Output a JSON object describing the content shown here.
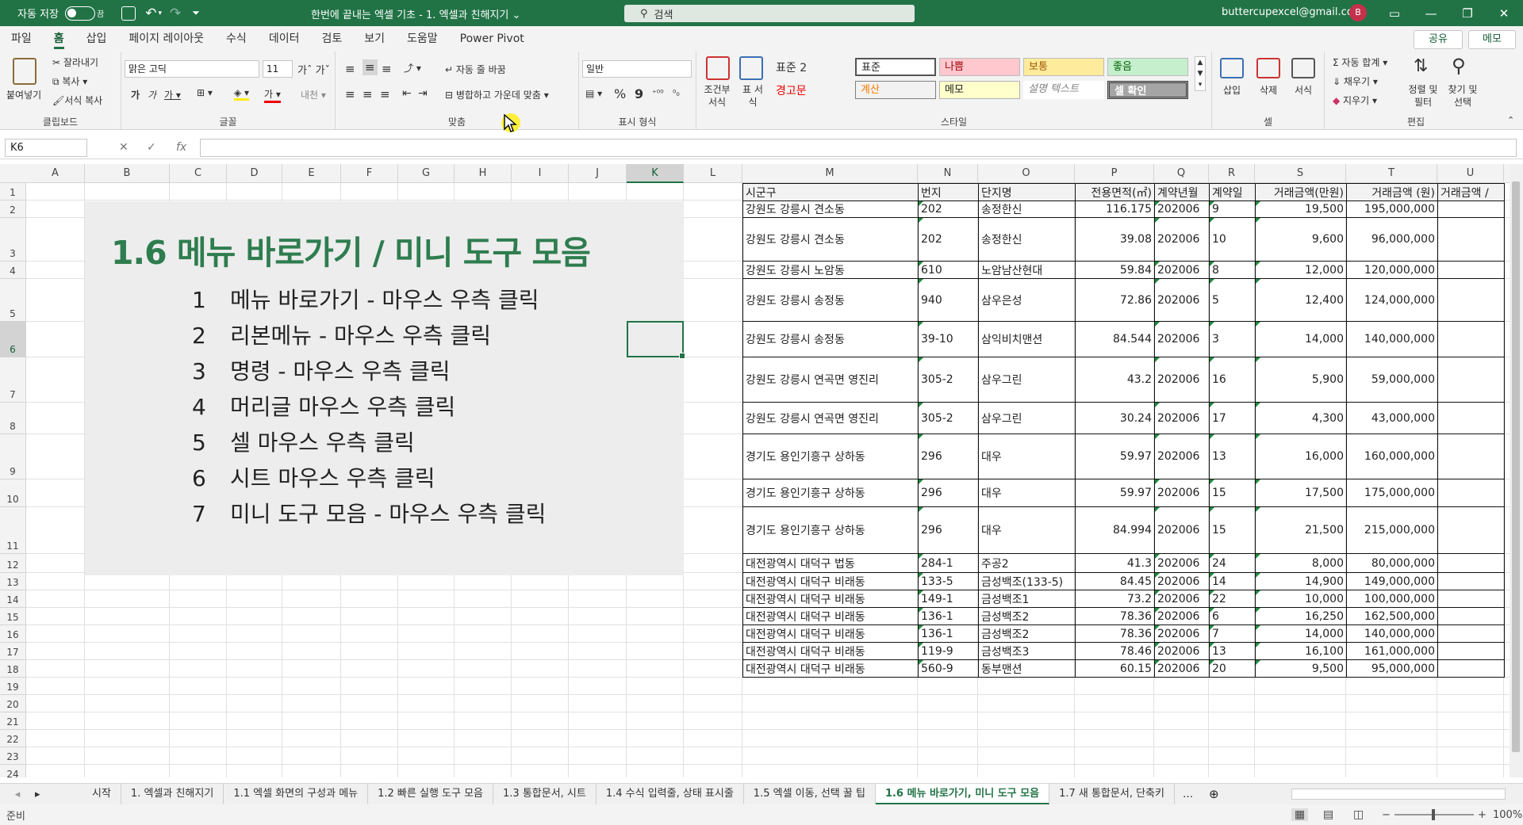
{
  "titlebar": {
    "autosave": "자동 저장",
    "autosave_state": "끔",
    "title": "한번에 끝내는 엑셀 기초 - 1. 엑셀과 친해지기 ⌄",
    "search": "검색",
    "account": "buttercupexcel@gmail.com",
    "avatar": "B"
  },
  "menu": [
    "파일",
    "홈",
    "삽입",
    "페이지 레이아웃",
    "수식",
    "데이터",
    "검토",
    "보기",
    "도움말",
    "Power Pivot"
  ],
  "share": "공유",
  "memo": "메모",
  "ribbon": {
    "clipboard": {
      "label": "클립보드",
      "paste": "붙여넣기",
      "cut": "잘라내기",
      "copy": "복사",
      "format_painter": "서식 복사"
    },
    "font": {
      "label": "글꼴",
      "name": "맑은 고딕",
      "size": "11"
    },
    "align": {
      "label": "맞춤",
      "wrap": "자동 줄 바꿈",
      "merge": "병합하고 가운데 맞춤"
    },
    "number": {
      "label": "표시 형식",
      "format": "일반"
    },
    "styles": {
      "label": "스타일",
      "cond": "조건부 서식",
      "table": "표 서식",
      "style_name": "표준 2",
      "warn": "경고문",
      "cells": [
        "표준",
        "나쁨",
        "보통",
        "좋음",
        "계산",
        "메모",
        "설명 텍스트",
        "셀 확인"
      ]
    },
    "cells": {
      "label": "셀",
      "insert": "삽입",
      "delete": "삭제",
      "format": "서식"
    },
    "edit": {
      "label": "편집",
      "autosum": "자동 합계",
      "fill": "채우기",
      "clear": "지우기",
      "sort": "정렬 및 필터",
      "find": "찾기 및 선택"
    }
  },
  "namebox": "K6",
  "columns": [
    "A",
    "B",
    "C",
    "D",
    "E",
    "F",
    "G",
    "H",
    "I",
    "J",
    "K",
    "L",
    "M",
    "N",
    "O",
    "P",
    "Q",
    "R",
    "S",
    "T",
    "U"
  ],
  "rows": [
    "1",
    "2",
    "3",
    "4",
    "5",
    "6",
    "7",
    "8",
    "9",
    "10",
    "11",
    "12",
    "13",
    "14",
    "15",
    "16",
    "17",
    "18",
    "19",
    "20",
    "21",
    "22",
    "23",
    "24"
  ],
  "slide": {
    "title": "1.6 메뉴 바로가기 / 미니 도구 모음",
    "items": [
      {
        "n": "1",
        "text": "메뉴 바로가기  - 마우스 우측 클릭"
      },
      {
        "n": "2",
        "text": "리본메뉴 - 마우스 우측 클릭"
      },
      {
        "n": "3",
        "text": "명령 - 마우스 우측 클릭"
      },
      {
        "n": "4",
        "text": "머리글 마우스 우측 클릭"
      },
      {
        "n": "5",
        "text": "셀 마우스 우측 클릭"
      },
      {
        "n": "6",
        "text": "시트 마우스 우측 클릭"
      },
      {
        "n": "7",
        "text": "미니 도구 모음 - 마우스 우측 클릭"
      }
    ]
  },
  "table": {
    "headers": [
      "시군구",
      "번지",
      "단지명",
      "전용면적(㎡)",
      "계약년월",
      "계약일",
      "거래금액(만원)",
      "거래금액 (원)",
      "거래금액 / "
    ],
    "rows": [
      [
        "강원도 강릉시 견소동",
        "202",
        "송정한신",
        "116.175",
        "202006",
        "9",
        "19,500",
        "195,000,000"
      ],
      [
        "강원도 강릉시 견소동",
        "202",
        "송정한신",
        "39.08",
        "202006",
        "10",
        "9,600",
        "96,000,000"
      ],
      [
        "강원도 강릉시 노암동",
        "610",
        "노암남산현대",
        "59.84",
        "202006",
        "8",
        "12,000",
        "120,000,000"
      ],
      [
        "강원도 강릉시 송정동",
        "940",
        "삼우은성",
        "72.86",
        "202006",
        "5",
        "12,400",
        "124,000,000"
      ],
      [
        "강원도 강릉시 송정동",
        "39-10",
        "삼익비치맨션",
        "84.544",
        "202006",
        "3",
        "14,000",
        "140,000,000"
      ],
      [
        "강원도 강릉시 연곡면 영진리",
        "305-2",
        "삼우그린",
        "43.2",
        "202006",
        "16",
        "5,900",
        "59,000,000"
      ],
      [
        "강원도 강릉시 연곡면 영진리",
        "305-2",
        "삼우그린",
        "30.24",
        "202006",
        "17",
        "4,300",
        "43,000,000"
      ],
      [
        "경기도 용인기흥구 상하동",
        "296",
        "대우",
        "59.97",
        "202006",
        "13",
        "16,000",
        "160,000,000"
      ],
      [
        "경기도 용인기흥구 상하동",
        "296",
        "대우",
        "59.97",
        "202006",
        "15",
        "17,500",
        "175,000,000"
      ],
      [
        "경기도 용인기흥구 상하동",
        "296",
        "대우",
        "84.994",
        "202006",
        "15",
        "21,500",
        "215,000,000"
      ],
      [
        "대전광역시 대덕구 법동",
        "284-1",
        "주공2",
        "41.3",
        "202006",
        "24",
        "8,000",
        "80,000,000"
      ],
      [
        "대전광역시 대덕구 비래동",
        "133-5",
        "금성백조(133-5)",
        "84.45",
        "202006",
        "14",
        "14,900",
        "149,000,000"
      ],
      [
        "대전광역시 대덕구 비래동",
        "149-1",
        "금성백조1",
        "73.2",
        "202006",
        "22",
        "10,000",
        "100,000,000"
      ],
      [
        "대전광역시 대덕구 비래동",
        "136-1",
        "금성백조2",
        "78.36",
        "202006",
        "6",
        "16,250",
        "162,500,000"
      ],
      [
        "대전광역시 대덕구 비래동",
        "136-1",
        "금성백조2",
        "78.36",
        "202006",
        "7",
        "14,000",
        "140,000,000"
      ],
      [
        "대전광역시 대덕구 비래동",
        "119-9",
        "금성백조3",
        "78.46",
        "202006",
        "13",
        "16,100",
        "161,000,000"
      ],
      [
        "대전광역시 대덕구 비래동",
        "560-9",
        "동부맨션",
        "60.15",
        "202006",
        "20",
        "9,500",
        "95,000,000"
      ]
    ]
  },
  "sheets": [
    "시작",
    "1. 엑셀과 친해지기",
    "1.1 엑셀 화면의 구성과 메뉴",
    "1.2 빠른 실행 도구 모음",
    "1.3 통합문서, 시트",
    "1.4 수식 입력줄, 상태 표시줄",
    "1.5 엑셀 이동, 선택 꿀 팁",
    "1.6 메뉴 바로가기, 미니 도구 모음",
    "1.7 새 통합문서, 단축키"
  ],
  "status": {
    "ready": "준비",
    "zoom": "100%"
  }
}
